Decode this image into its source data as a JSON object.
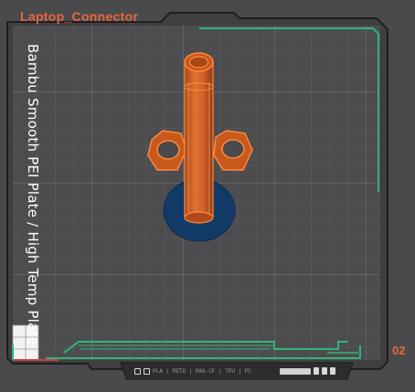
{
  "plate": {
    "name": "Laptop_Connector",
    "type_label": "Bambu Smooth PEI Plate / High Temp Plate",
    "number": "02"
  },
  "colors": {
    "background": "#4a4a4d",
    "grid_minor": "#6b6b6e",
    "grid_major": "#7a7a7d",
    "accent_green": "#2fb673",
    "accent_orange": "#e8693a",
    "model_orange": "#c9581c",
    "model_edge": "#ff8a3d",
    "disc_blue": "#123a66"
  },
  "icons": {
    "view_cube": "view-cube-icon",
    "toolbar": [
      "grid-icon",
      "layout-icon",
      "lock-icon",
      "copy-icon",
      "delete-icon"
    ]
  },
  "toolbar": {
    "text": "PLA | PETG | PA6-CF | TPU | PC"
  }
}
